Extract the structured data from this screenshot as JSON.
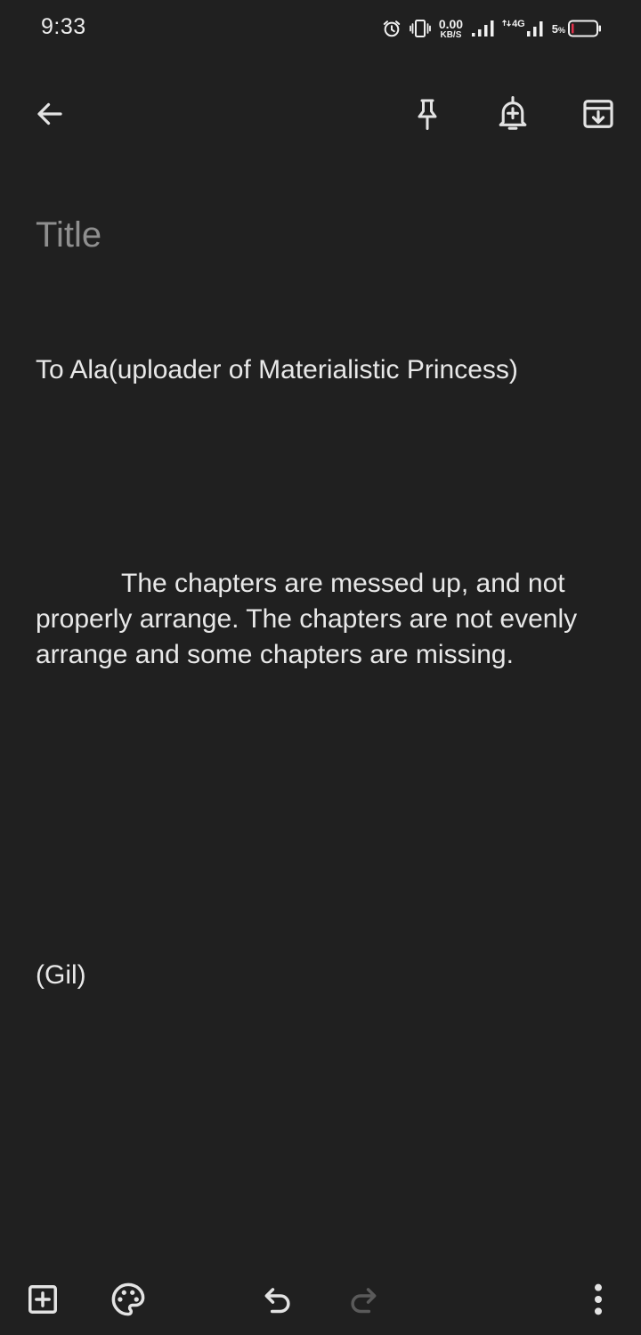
{
  "status_bar": {
    "time": "9:33",
    "net_speed_value": "0.00",
    "net_speed_unit": "KB/S",
    "network_type": "4G",
    "battery_percent": "5",
    "icons": [
      "alarm-icon",
      "vibrate-icon",
      "signal-icon",
      "battery-icon"
    ],
    "battery_low_color": "#e0304a"
  },
  "toolbar": {
    "icons": [
      "back-arrow-icon",
      "pin-icon",
      "reminder-bell-icon",
      "archive-icon"
    ]
  },
  "note": {
    "title_placeholder": "Title",
    "lines": {
      "greeting": "To Ala(uploader of Materialistic Princess)",
      "paragraph": "The chapters are messed up, and not properly arrange. The chapters are not evenly arrange and some chapters are missing.",
      "signature": "(Gil)"
    }
  },
  "bottom_bar": {
    "icons": [
      "add-box-icon",
      "palette-icon",
      "undo-icon",
      "redo-icon",
      "more-vert-icon"
    ],
    "redo_enabled": false
  },
  "colors": {
    "background": "#202020",
    "text": "#e8e8e8",
    "placeholder": "#8f8f8f",
    "icon": "#e3e3e3",
    "icon_disabled": "#5a5a5a"
  }
}
